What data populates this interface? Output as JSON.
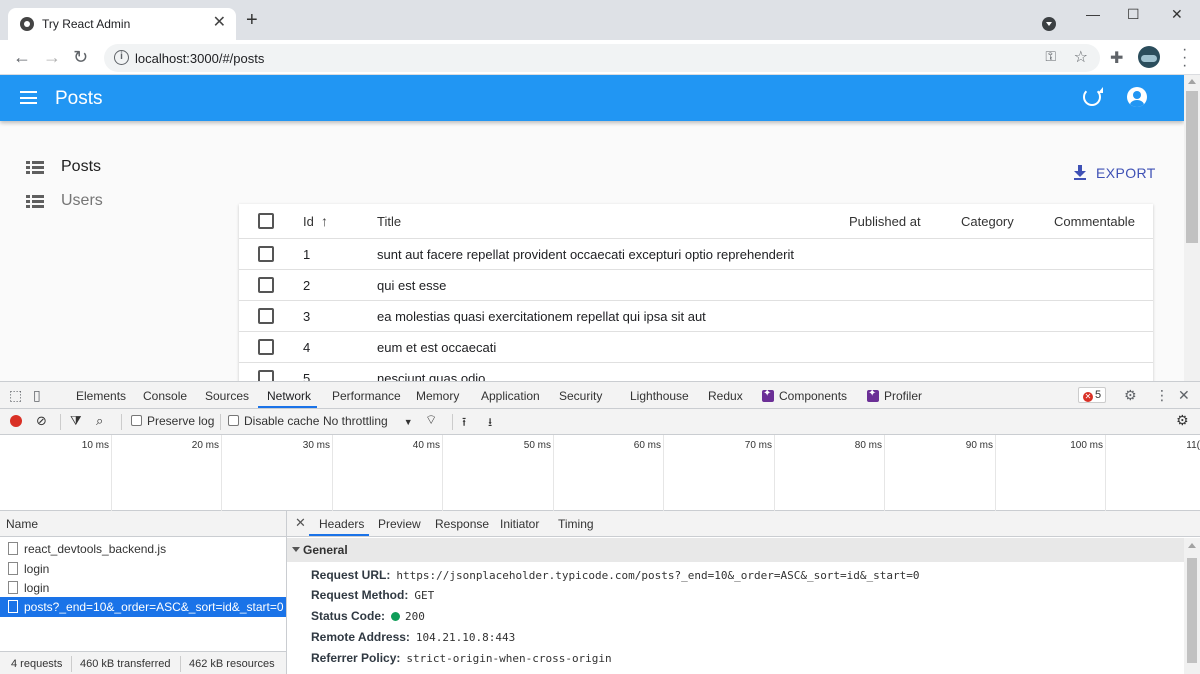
{
  "browser": {
    "tab_title": "Try React Admin",
    "tab_close": "✕",
    "new_tab": "+",
    "url": "localhost:3000/#/posts",
    "window_controls": [
      "—",
      "☐",
      "✕"
    ]
  },
  "app": {
    "title": "Posts",
    "primary_color": "#2196f3",
    "menu": [
      {
        "label": "Posts",
        "active": true
      },
      {
        "label": "Users",
        "active": false
      }
    ],
    "export_label": "EXPORT",
    "table": {
      "columns": [
        "Id",
        "Title",
        "Published at",
        "Category",
        "Commentable"
      ],
      "sorted_column": "Id",
      "sort_direction": "ascending",
      "rows": [
        {
          "id": "1",
          "title": "sunt aut facere repellat provident occaecati excepturi optio reprehenderit"
        },
        {
          "id": "2",
          "title": "qui est esse"
        },
        {
          "id": "3",
          "title": "ea molestias quasi exercitationem repellat qui ipsa sit aut"
        },
        {
          "id": "4",
          "title": "eum et est occaecati"
        },
        {
          "id": "5",
          "title": "nesciunt quas odio"
        }
      ]
    }
  },
  "devtools": {
    "tabs": [
      "Elements",
      "Console",
      "Sources",
      "Network",
      "Performance",
      "Memory",
      "Application",
      "Security",
      "Lighthouse",
      "Redux",
      "Components",
      "Profiler"
    ],
    "active_tab": "Network",
    "error_count": "5",
    "toolbar": {
      "preserve_log": "Preserve log",
      "disable_cache": "Disable cache",
      "throttling": "No throttling"
    },
    "timeline_ticks": [
      "10 ms",
      "20 ms",
      "30 ms",
      "40 ms",
      "50 ms",
      "60 ms",
      "70 ms",
      "80 ms",
      "90 ms",
      "100 ms",
      "11("
    ],
    "name_header": "Name",
    "requests": [
      {
        "name": "react_devtools_backend.js",
        "selected": false
      },
      {
        "name": "login",
        "selected": false
      },
      {
        "name": "login",
        "selected": false
      },
      {
        "name": "posts?_end=10&_order=ASC&_sort=id&_start=0",
        "selected": true
      }
    ],
    "summary": {
      "requests": "4 requests",
      "transferred": "460 kB transferred",
      "resources": "462 kB resources"
    },
    "detail_tabs": [
      "Headers",
      "Preview",
      "Response",
      "Initiator",
      "Timing"
    ],
    "active_detail_tab": "Headers",
    "general_label": "General",
    "general": [
      {
        "key": "Request URL:",
        "value": "https://jsonplaceholder.typicode.com/posts?_end=10&_order=ASC&_sort=id&_start=0"
      },
      {
        "key": "Request Method:",
        "value": "GET"
      },
      {
        "key": "Status Code:",
        "value": "200"
      },
      {
        "key": "Remote Address:",
        "value": "104.21.10.8:443"
      },
      {
        "key": "Referrer Policy:",
        "value": "strict-origin-when-cross-origin"
      }
    ],
    "status_color": "#0f9d58"
  }
}
